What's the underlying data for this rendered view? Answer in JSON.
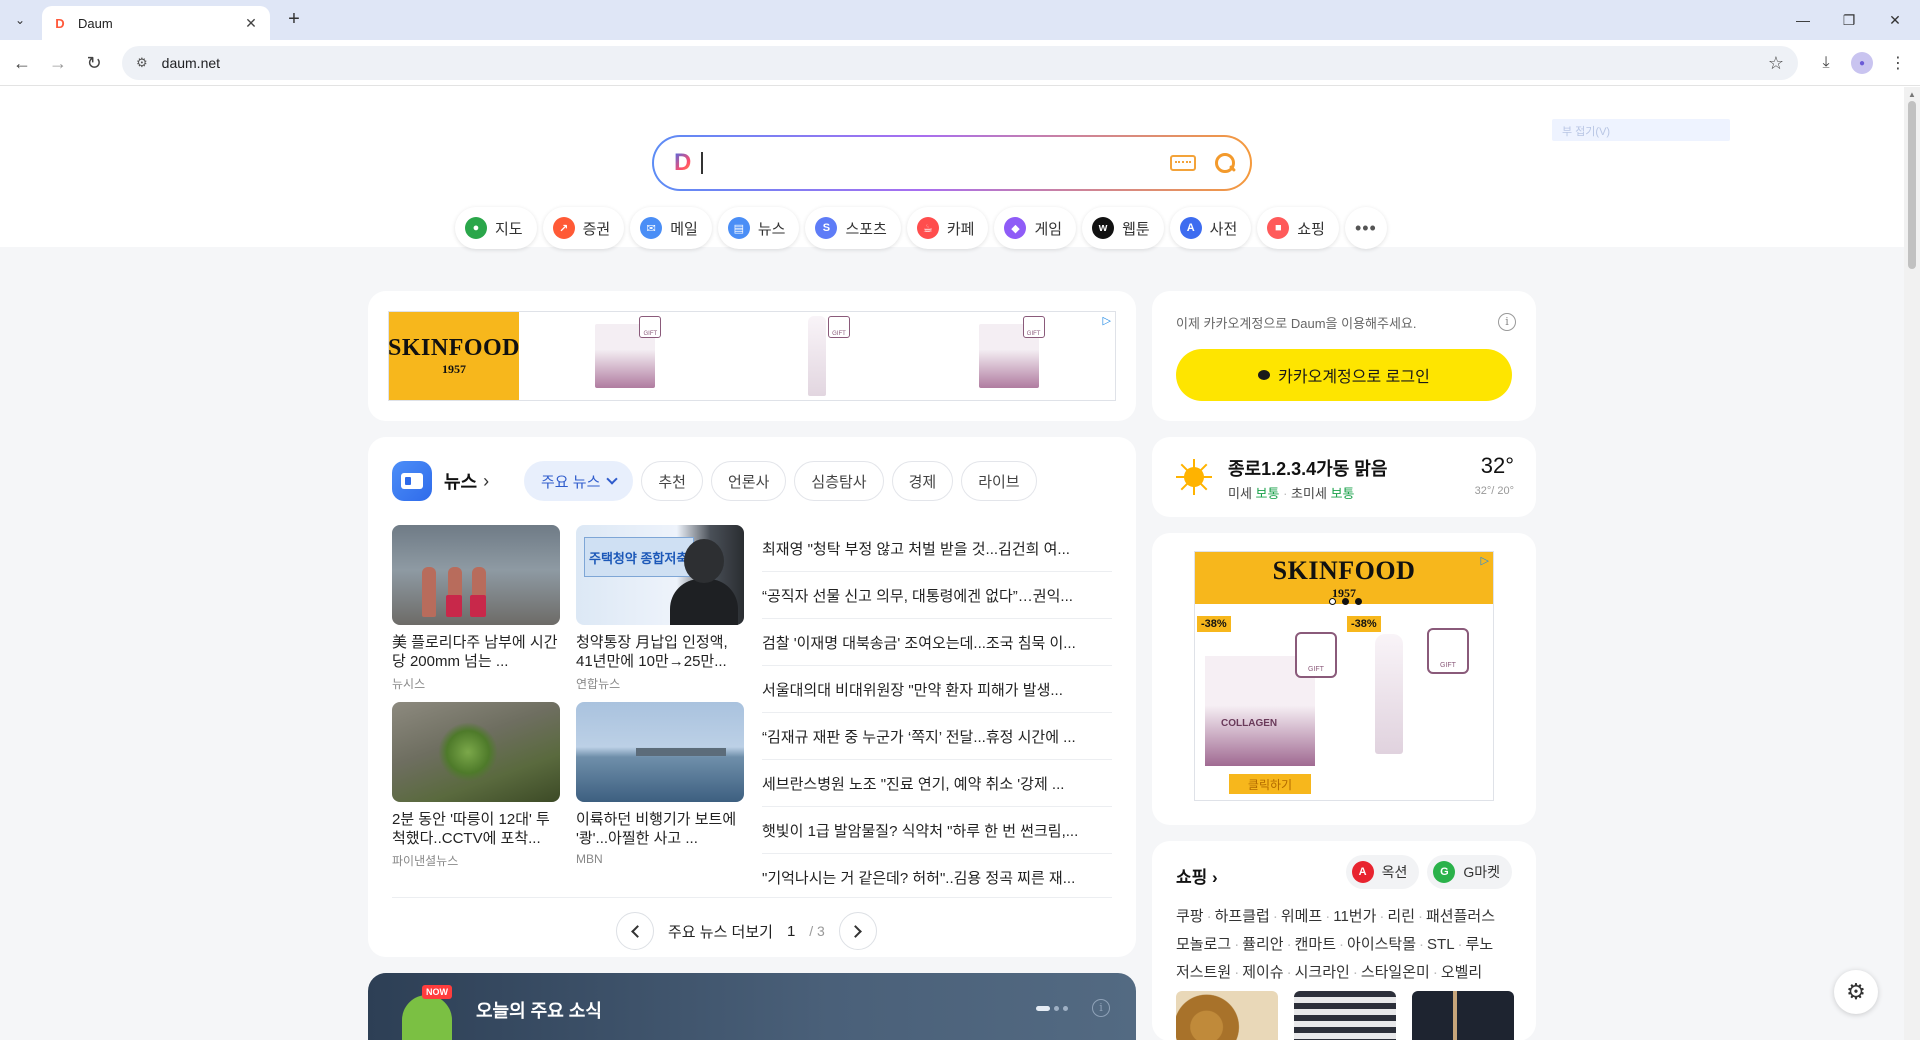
{
  "browser": {
    "tab_title": "Daum",
    "url": "daum.net",
    "tab_favicon": "D"
  },
  "search": {
    "logo": "D",
    "placeholder": ""
  },
  "services": [
    {
      "label": "지도",
      "icon": "map-pin-icon",
      "color": "#2aa64a"
    },
    {
      "label": "증권",
      "icon": "stock-chart-icon",
      "color": "#ff5a36"
    },
    {
      "label": "메일",
      "icon": "mail-icon",
      "color": "#4a8ef6"
    },
    {
      "label": "뉴스",
      "icon": "news-icon",
      "color": "#4a8ef6"
    },
    {
      "label": "스포츠",
      "icon": "sports-icon",
      "color": "#5e7cf7"
    },
    {
      "label": "카페",
      "icon": "cafe-icon",
      "color": "#ff4d4d"
    },
    {
      "label": "게임",
      "icon": "game-icon",
      "color": "#8f5cf7"
    },
    {
      "label": "웹툰",
      "icon": "webtoon-icon",
      "color": "#111111"
    },
    {
      "label": "사전",
      "icon": "dictionary-icon",
      "color": "#3d6cf0"
    },
    {
      "label": "쇼핑",
      "icon": "shopping-bag-icon",
      "color": "#ff5a5a"
    }
  ],
  "ad_top": {
    "brand": "SKINFOOD",
    "year": "1957",
    "gift": "GIFT"
  },
  "login": {
    "note": "이제 카카오계정으로 Daum을 이용해주세요.",
    "button": "카카오계정으로 로그인"
  },
  "news": {
    "title": "뉴스",
    "chips": [
      "주요 뉴스",
      "추천",
      "언론사",
      "심층탐사",
      "경제",
      "라이브"
    ],
    "thumbs": [
      {
        "caption": "美 플로리다주 남부에 시간당 200mm 넘는 ...",
        "source": "뉴시스"
      },
      {
        "caption": "청약통장 月납입 인정액, 41년만에 10만→25만...",
        "source": "연합뉴스"
      },
      {
        "caption": "2분 동안 '따릉이 12대' 투척했다..CCTV에 포착...",
        "source": "파이낸셜뉴스"
      },
      {
        "caption": "이륙하던 비행기가 보트에 '쾅'...아찔한 사고 ...",
        "source": "MBN"
      }
    ],
    "thumb2_sign": "주택청약 종합저축",
    "headlines": [
      "최재영 \"청탁 부정 않고 처벌 받을 것...김건희 여...",
      "“공직자 선물 신고 의무, 대통령에겐 없다”…권익...",
      "검찰 '이재명 대북송금' 조여오는데...조국 침묵 이...",
      "서울대의대 비대위원장 \"만약 환자 피해가 발생...",
      "“김재규 재판 중 누군가 ‘쪽지’ 전달...휴정 시간에 ...",
      "세브란스병원 노조 \"진료 연기, 예약 취소 '강제 ...",
      "햇빛이 1급 발암물질? 식약처 \"하루 한 번 썬크림,...",
      "\"기억나시는 거 같은데? 허허\"..김용 정곡 찌른 재..."
    ],
    "pager": {
      "label": "주요 뉴스 더보기",
      "current": "1",
      "total": "/ 3"
    }
  },
  "weather": {
    "location": "종로1.2.3.4가동 맑음",
    "fine_dust_label": "미세",
    "fine_dust_value": "보통",
    "ultrafine_label": "초미세",
    "ultrafine_value": "보통",
    "temp": "32°",
    "range": "32°/ 20°"
  },
  "ad_side": {
    "brand": "SKINFOOD",
    "year": "1957",
    "discount1": "-38%",
    "discount2": "-38%",
    "gift": "GIFT",
    "cta": "클릭하기",
    "product_text": "COLLAGEN"
  },
  "shopping": {
    "title": "쇼핑",
    "brands": [
      {
        "label": "옥션",
        "icon": "auction-icon",
        "color": "#e8242f"
      },
      {
        "label": "G마켓",
        "icon": "gmarket-icon",
        "color": "#2ab24a"
      }
    ],
    "links": [
      "쿠팡",
      "하프클럽",
      "위메프",
      "11번가",
      "리린",
      "패션플러스",
      "모놀로그",
      "퓰리안",
      "캔마트",
      "아이스탁몰",
      "STL",
      "루노",
      "저스트원",
      "제이슈",
      "시크라인",
      "스타일온미",
      "오벨리"
    ]
  },
  "today": {
    "badge": "NOW",
    "title": "오늘의 주요 소식"
  },
  "ghost": "부 접기(V)"
}
